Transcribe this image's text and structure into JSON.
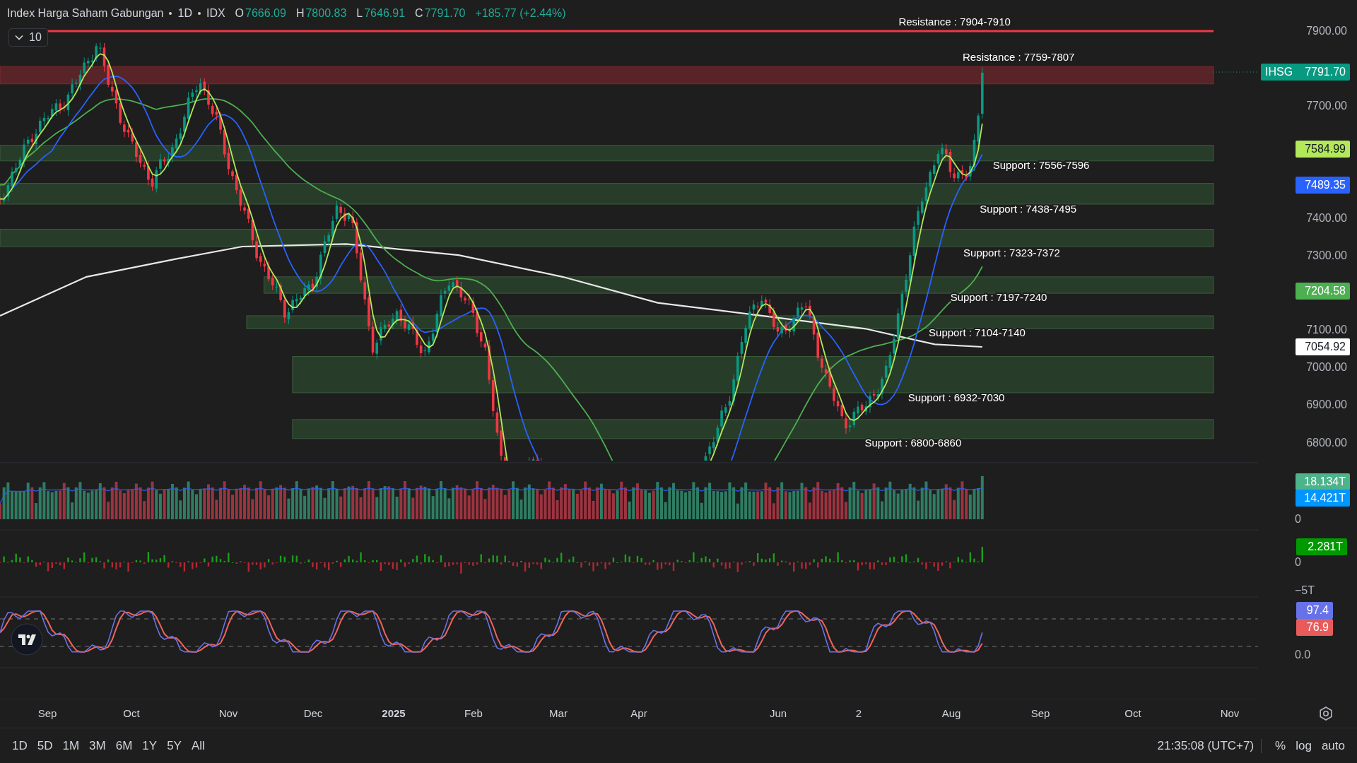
{
  "header": {
    "symbol": "Index Harga Saham Gabungan",
    "interval": "1D",
    "exchange": "IDX",
    "ohlc": [
      {
        "label": "O",
        "value": "7666.09"
      },
      {
        "label": "H",
        "value": "7800.83"
      },
      {
        "label": "L",
        "value": "7646.91"
      },
      {
        "label": "C",
        "value": "7791.70"
      }
    ],
    "change": "+185.77 (+2.44%)"
  },
  "indicator_toggle": {
    "count": "10",
    "expanded": false
  },
  "levels": [
    {
      "kind": "resistance-line",
      "label": "Resistance : 7904-7910"
    },
    {
      "kind": "resistance-zone",
      "label": "Resistance : 7759-7807"
    },
    {
      "kind": "support-zone",
      "label": "Support : 7556-7596"
    },
    {
      "kind": "support-zone",
      "label": "Support : 7438-7495"
    },
    {
      "kind": "support-zone",
      "label": "Support : 7323-7372"
    },
    {
      "kind": "support-zone",
      "label": "Support : 7197-7240"
    },
    {
      "kind": "support-zone",
      "label": "Support : 7104-7140"
    },
    {
      "kind": "support-zone",
      "label": "Support : 6932-7030"
    },
    {
      "kind": "support-zone",
      "label": "Support : 6800-6860"
    }
  ],
  "price_axis": {
    "ticks": [
      "7900.00",
      "7700.00",
      "7400.00",
      "7300.00",
      "7100.00",
      "7000.00",
      "6900.00",
      "6800.00"
    ],
    "tags": [
      {
        "name": "IHSG",
        "value": "7791.70",
        "color": "#089981"
      },
      {
        "value": "7584.99",
        "color": "#b2e85a"
      },
      {
        "value": "7489.35",
        "color": "#2962ff"
      },
      {
        "value": "7204.58",
        "color": "#4caf50"
      },
      {
        "value": "7054.92",
        "color": "#ffffff"
      }
    ]
  },
  "volume_pane": {
    "tags": [
      {
        "value": "18.134T",
        "color": "#4db38a"
      },
      {
        "value": "14.421T",
        "color": "#0096ff"
      }
    ],
    "ticks": [
      "0"
    ]
  },
  "flow_pane": {
    "tags": [
      {
        "value": "2.281T",
        "color": "#009900"
      }
    ],
    "ticks": [
      "0",
      "−5T"
    ]
  },
  "stochastic_pane": {
    "tags": [
      {
        "value": "97.4",
        "color": "#6872e8"
      },
      {
        "value": "76.9",
        "color": "#e85b5b"
      }
    ],
    "ticks": [
      "0.0"
    ]
  },
  "time_axis": [
    {
      "label": "Sep",
      "kind": "month"
    },
    {
      "label": "Oct",
      "kind": "month"
    },
    {
      "label": "Nov",
      "kind": "month"
    },
    {
      "label": "Dec",
      "kind": "month"
    },
    {
      "label": "2025",
      "kind": "year"
    },
    {
      "label": "Feb",
      "kind": "month"
    },
    {
      "label": "Mar",
      "kind": "month"
    },
    {
      "label": "Apr",
      "kind": "month"
    },
    {
      "label": "Jun",
      "kind": "month"
    },
    {
      "label": "2",
      "kind": "month"
    },
    {
      "label": "Aug",
      "kind": "month"
    },
    {
      "label": "Sep",
      "kind": "month"
    },
    {
      "label": "Oct",
      "kind": "month"
    },
    {
      "label": "Nov",
      "kind": "month"
    }
  ],
  "range_buttons": [
    "1D",
    "5D",
    "1M",
    "3M",
    "6M",
    "1Y",
    "5Y",
    "All"
  ],
  "clock": "21:35:08 (UTC+7)",
  "scale_buttons": [
    "%",
    "log",
    "auto"
  ]
}
